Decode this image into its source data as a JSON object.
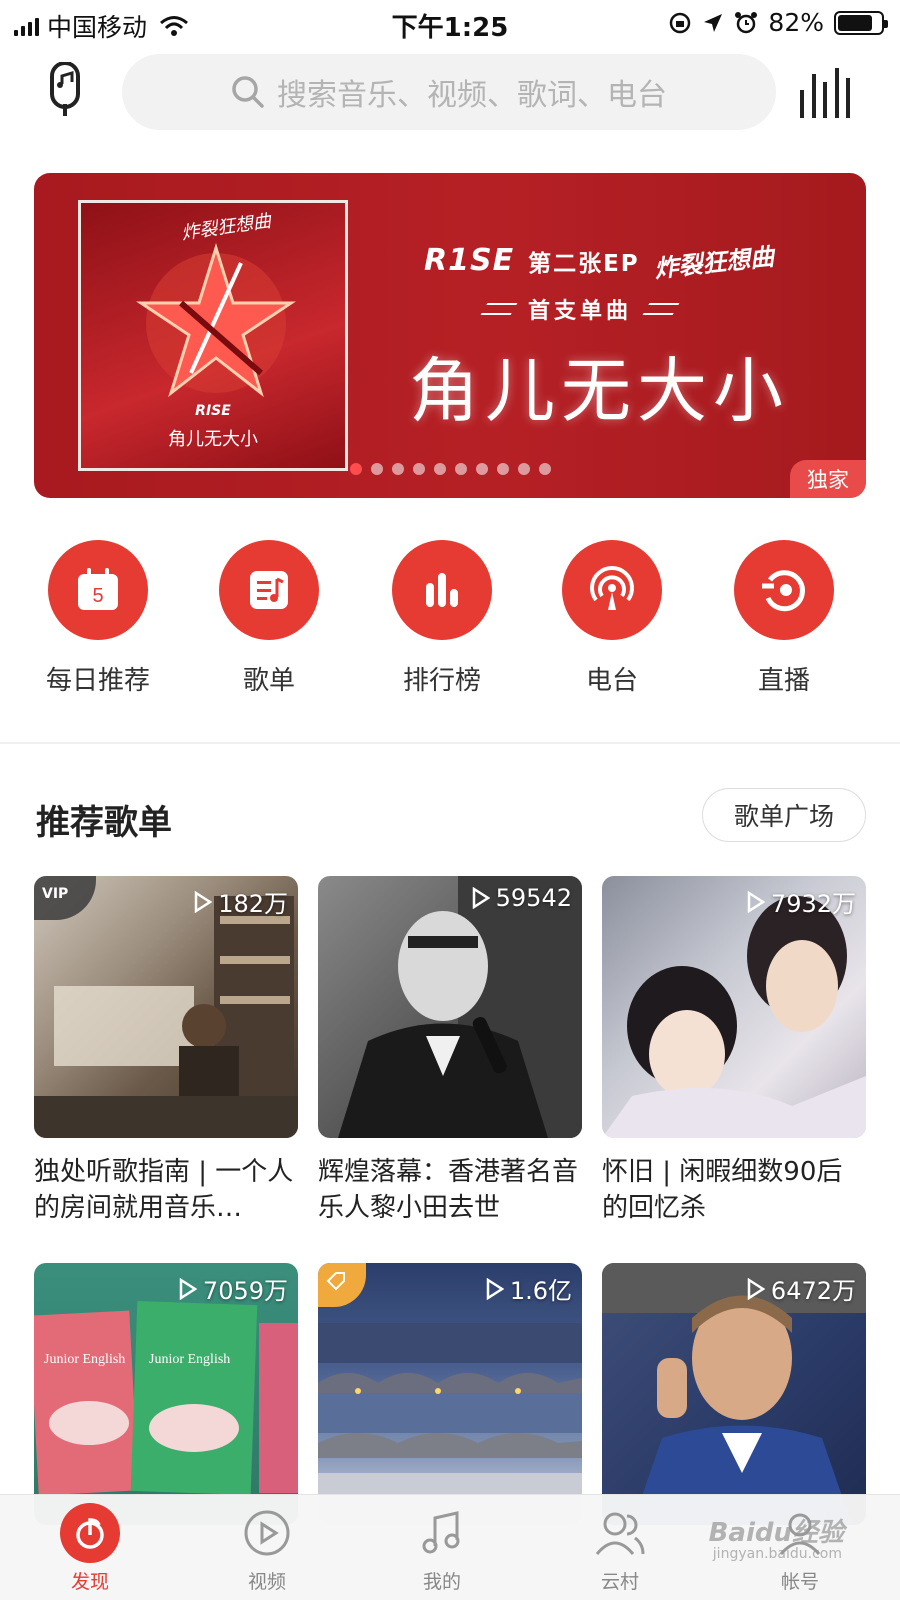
{
  "status_bar": {
    "carrier": "中国移动",
    "time": "下午1:25",
    "battery_percent": "82%",
    "battery_level": 0.82
  },
  "search": {
    "placeholder": "搜索音乐、视频、歌词、电台"
  },
  "banner": {
    "brand": "R1SE",
    "ep_label": "第二张EP",
    "album_script": "炸裂狂想曲",
    "subtitle": "首支单曲",
    "song_title": "角儿无大小",
    "cover_title": "角儿无大小",
    "cover_brand": "RISE",
    "badge": "独家",
    "dot_count": 10,
    "active_dot": 0
  },
  "categories": [
    {
      "label": "每日推荐",
      "icon": "calendar-icon",
      "day": "5"
    },
    {
      "label": "歌单",
      "icon": "playlist-icon"
    },
    {
      "label": "排行榜",
      "icon": "chart-icon"
    },
    {
      "label": "电台",
      "icon": "radio-icon"
    },
    {
      "label": "直播",
      "icon": "live-icon"
    }
  ],
  "section": {
    "title": "推荐歌单",
    "more_button": "歌单广场"
  },
  "playlists": [
    {
      "title": "独处听歌指南 | 一个人的房间就用音乐…",
      "plays": "182万",
      "corner": "VIP"
    },
    {
      "title": "辉煌落幕：香港著名音乐人黎小田去世",
      "plays": "59542"
    },
    {
      "title": "怀旧 | 闲暇细数90后的回忆杀",
      "plays": "7932万"
    },
    {
      "title": "",
      "plays": "7059万"
    },
    {
      "title": "",
      "plays": "1.6亿",
      "corner": "tag"
    },
    {
      "title": "",
      "plays": "6472万"
    }
  ],
  "bottom_nav": [
    {
      "label": "发现",
      "icon": "discover-icon",
      "active": true
    },
    {
      "label": "视频",
      "icon": "video-icon"
    },
    {
      "label": "我的",
      "icon": "music-note-icon"
    },
    {
      "label": "云村",
      "icon": "friends-icon"
    },
    {
      "label": "帐号",
      "icon": "account-icon"
    }
  ],
  "watermark": {
    "text": "Baidu经验",
    "url_text": "jingyan.baidu.com"
  },
  "colors": {
    "accent": "#e63b33",
    "banner_red": "#b52025",
    "badge": "#e94b4b"
  }
}
